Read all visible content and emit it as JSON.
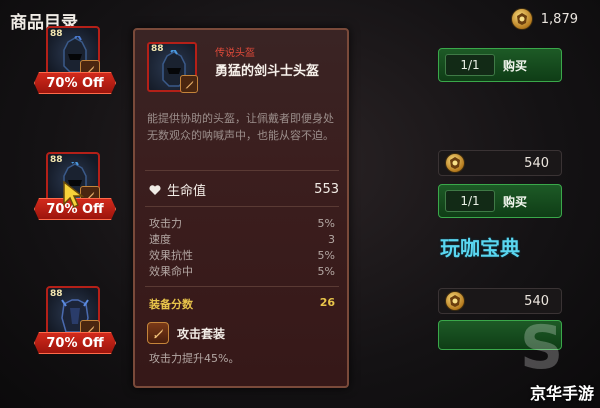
{
  "header": {
    "title": "商品目录"
  },
  "currency": {
    "icon": "currency-crest-icon",
    "amount": "1,879"
  },
  "items": [
    {
      "level": "88",
      "discount": "70% Off"
    },
    {
      "level": "88",
      "discount": "70% Off"
    },
    {
      "level": "88",
      "discount": "70% Off"
    }
  ],
  "right_column": {
    "rows": [
      {
        "qty": "1/1",
        "buy_label": "购买"
      },
      {
        "price": "540",
        "qty": "1/1",
        "buy_label": "购买"
      },
      {
        "price": "540"
      }
    ]
  },
  "tooltip": {
    "level": "88",
    "rarity": "传说头盔",
    "name": "勇猛的剑斗士头盔",
    "description": "能提供协助的头盔，让佩戴者即便身处无数观众的呐喊声中，也能从容不迫。",
    "main_stat": {
      "label": "生命值",
      "value": "553"
    },
    "stats": [
      {
        "label": "攻击力",
        "value": "5%"
      },
      {
        "label": "速度",
        "value": "3"
      },
      {
        "label": "效果抗性",
        "value": "5%"
      },
      {
        "label": "效果命中",
        "value": "5%"
      }
    ],
    "score": {
      "label": "装备分数",
      "value": "26"
    },
    "set": {
      "label": "攻击套装",
      "description": "攻击力提升45%。"
    }
  },
  "watermarks": {
    "primary": "玩咖宝典",
    "secondary": "京华手游"
  },
  "colors": {
    "discount_red": "#c81e14",
    "buy_green": "#1d5a26",
    "rarity_red": "#e04a3a",
    "score_gold": "#e8c44a",
    "watermark_cyan": "#5ad6f0"
  }
}
